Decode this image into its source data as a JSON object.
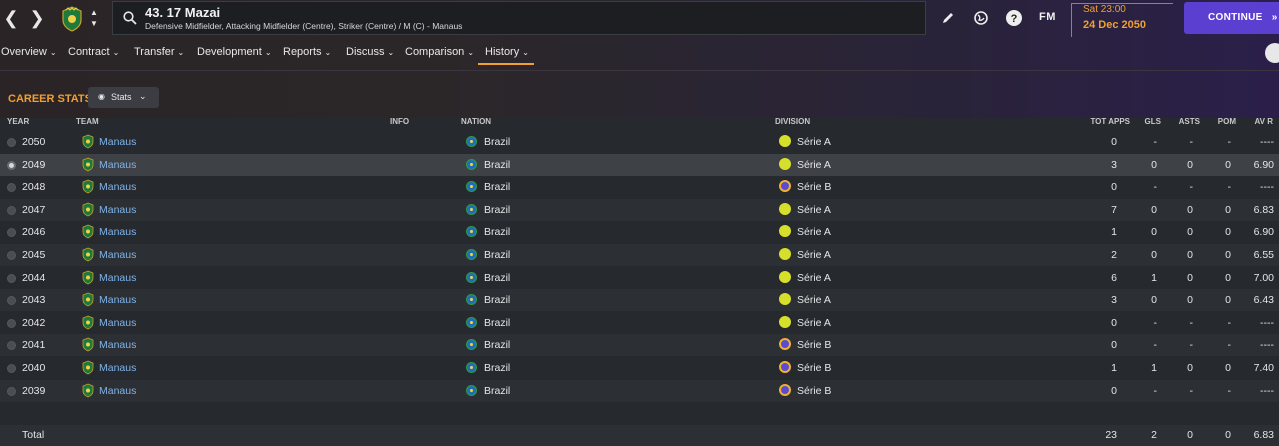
{
  "header": {
    "player_title": "43. 17 Mazai",
    "player_subtitle": "Defensive Midfielder, Attacking Midfielder (Centre), Striker (Centre) / M (C) - Manaus",
    "fm_label": "FM",
    "date_time": "Sat 23:00",
    "date_day": "24 Dec 2050",
    "continue_label": "CONTINUE",
    "icons": [
      "back-arrow-icon",
      "forward-arrow-icon",
      "club-badge",
      "search-icon",
      "edit-icon",
      "globe-icon",
      "help-icon",
      "fm-logo",
      "continue-arrow-icon"
    ]
  },
  "tabs": [
    "Overview",
    "Contract",
    "Transfer",
    "Development",
    "Reports",
    "Discuss",
    "Comparison",
    "History"
  ],
  "active_tab": "History",
  "section": {
    "title": "CAREER STATS",
    "stats_label": "Stats"
  },
  "columns": {
    "year": "YEAR",
    "team": "TEAM",
    "info": "INFO",
    "nation": "NATION",
    "division": "DIVISION",
    "apps": "TOT APPS",
    "gls": "GLS",
    "asts": "ASTS",
    "pom": "POM",
    "avr": "AV R"
  },
  "rows": [
    {
      "year": "2050",
      "team": "Manaus",
      "nation": "Brazil",
      "division": "Série A",
      "tier": "A",
      "apps": "0",
      "gls": "-",
      "asts": "-",
      "pom": "-",
      "avr": "----"
    },
    {
      "year": "2049",
      "team": "Manaus",
      "nation": "Brazil",
      "division": "Série A",
      "tier": "A",
      "apps": "3",
      "gls": "0",
      "asts": "0",
      "pom": "0",
      "avr": "6.90"
    },
    {
      "year": "2048",
      "team": "Manaus",
      "nation": "Brazil",
      "division": "Série B",
      "tier": "B",
      "apps": "0",
      "gls": "-",
      "asts": "-",
      "pom": "-",
      "avr": "----"
    },
    {
      "year": "2047",
      "team": "Manaus",
      "nation": "Brazil",
      "division": "Série A",
      "tier": "A",
      "apps": "7",
      "gls": "0",
      "asts": "0",
      "pom": "0",
      "avr": "6.83"
    },
    {
      "year": "2046",
      "team": "Manaus",
      "nation": "Brazil",
      "division": "Série A",
      "tier": "A",
      "apps": "1",
      "gls": "0",
      "asts": "0",
      "pom": "0",
      "avr": "6.90"
    },
    {
      "year": "2045",
      "team": "Manaus",
      "nation": "Brazil",
      "division": "Série A",
      "tier": "A",
      "apps": "2",
      "gls": "0",
      "asts": "0",
      "pom": "0",
      "avr": "6.55"
    },
    {
      "year": "2044",
      "team": "Manaus",
      "nation": "Brazil",
      "division": "Série A",
      "tier": "A",
      "apps": "6",
      "gls": "1",
      "asts": "0",
      "pom": "0",
      "avr": "7.00"
    },
    {
      "year": "2043",
      "team": "Manaus",
      "nation": "Brazil",
      "division": "Série A",
      "tier": "A",
      "apps": "3",
      "gls": "0",
      "asts": "0",
      "pom": "0",
      "avr": "6.43"
    },
    {
      "year": "2042",
      "team": "Manaus",
      "nation": "Brazil",
      "division": "Série A",
      "tier": "A",
      "apps": "0",
      "gls": "-",
      "asts": "-",
      "pom": "-",
      "avr": "----"
    },
    {
      "year": "2041",
      "team": "Manaus",
      "nation": "Brazil",
      "division": "Série B",
      "tier": "B",
      "apps": "0",
      "gls": "-",
      "asts": "-",
      "pom": "-",
      "avr": "----"
    },
    {
      "year": "2040",
      "team": "Manaus",
      "nation": "Brazil",
      "division": "Série B",
      "tier": "B",
      "apps": "1",
      "gls": "1",
      "asts": "0",
      "pom": "0",
      "avr": "7.40"
    },
    {
      "year": "2039",
      "team": "Manaus",
      "nation": "Brazil",
      "division": "Série B",
      "tier": "B",
      "apps": "0",
      "gls": "-",
      "asts": "-",
      "pom": "-",
      "avr": "----"
    }
  ],
  "selected_year": "2049",
  "total": {
    "label": "Total",
    "apps": "23",
    "gls": "2",
    "asts": "0",
    "pom": "0",
    "avr": "6.83"
  },
  "colors": {
    "accent": "#f0a030",
    "continue": "#5a3fd0",
    "link": "#7fb3e8"
  }
}
